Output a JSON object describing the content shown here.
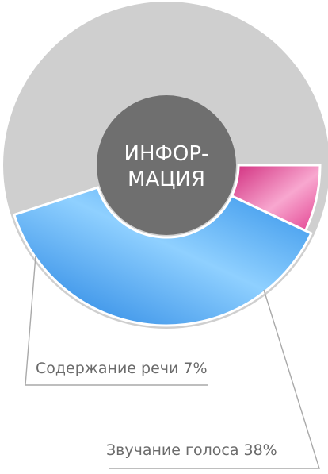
{
  "chart_data": {
    "type": "pie",
    "center_text": [
      "ИНФОР-",
      "МАЦИЯ"
    ],
    "slices": [
      {
        "key": "speech",
        "label": "Содержание речи 7%",
        "value": 7,
        "highlighted": true,
        "color": "#e23f8f"
      },
      {
        "key": "voice",
        "label": "Звучание голоса 38%",
        "value": 38,
        "highlighted": true,
        "color": "#3a9cf0"
      },
      {
        "key": "other",
        "label": "",
        "value": 55,
        "highlighted": false,
        "color": "#cfcfcf"
      }
    ],
    "colors": {
      "background_ring": "#cfcfcf",
      "center": "#6f6f6f",
      "label_text": "#6b6b6b",
      "leader": "#a9a9a9"
    }
  }
}
